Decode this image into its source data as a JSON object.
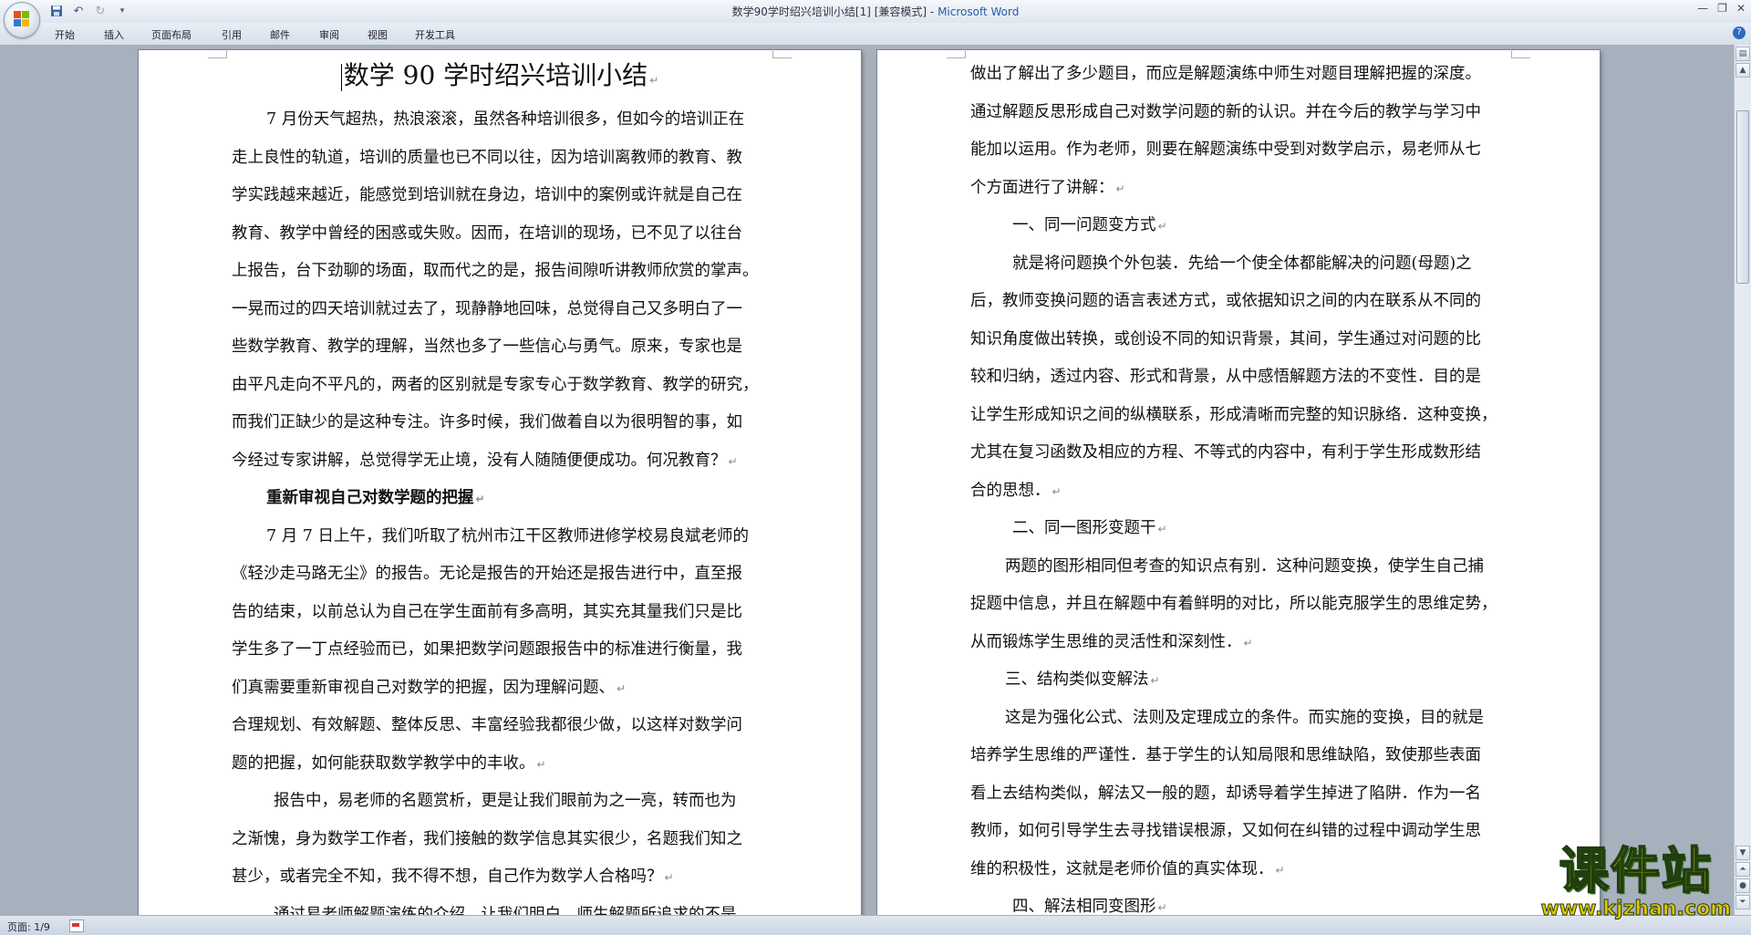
{
  "window": {
    "title": "数学90学时绍兴培训小结[1] [兼容模式] - ",
    "app_name": "Microsoft Word"
  },
  "ribbon_tabs": [
    "开始",
    "插入",
    "页面布局",
    "引用",
    "邮件",
    "审阅",
    "视图",
    "开发工具"
  ],
  "document": {
    "left_page": {
      "title": "数学 90 学时绍兴培训小结",
      "lines": [
        {
          "text": "7 月份天气超热，热浪滚滚，虽然各种培训很多，但如今的培训正在",
          "style": "indent",
          "mark": false
        },
        {
          "text": "走上良性的轨道，培训的质量也已不同以往，因为培训离教师的教育、教",
          "style": "",
          "mark": false
        },
        {
          "text": "学实践越来越近，能感觉到培训就在身边，培训中的案例或许就是自己在",
          "style": "",
          "mark": false
        },
        {
          "text": "教育、教学中曾经的困惑或失败。因而，在培训的现场，已不见了以往台",
          "style": "",
          "mark": false
        },
        {
          "text": "上报告，台下劲聊的场面，取而代之的是，报告间隙听讲教师欣赏的掌声。",
          "style": "",
          "mark": false
        },
        {
          "text": "一晃而过的四天培训就过去了，现静静地回味，总觉得自己又多明白了一",
          "style": "",
          "mark": false
        },
        {
          "text": "些数学教育、教学的理解，当然也多了一些信心与勇气。原来，专家也是",
          "style": "",
          "mark": false
        },
        {
          "text": "由平凡走向不平凡的，两者的区别就是专家专心于数学教育、教学的研究，",
          "style": "",
          "mark": false
        },
        {
          "text": "而我们正缺少的是这种专注。许多时候，我们做着自以为很明智的事，如",
          "style": "",
          "mark": false
        },
        {
          "text": "今经过专家讲解，总觉得学无止境，没有人随随便便成功。何况教育？",
          "style": "",
          "mark": true
        },
        {
          "text": "重新审视自己对数学题的把握",
          "style": "heading-bold",
          "mark": true
        },
        {
          "text": "7 月 7 日上午，我们听取了杭州市江干区教师进修学校易良斌老师的",
          "style": "indent",
          "mark": false
        },
        {
          "text": "《轻沙走马路无尘》的报告。无论是报告的开始还是报告进行中，直至报",
          "style": "",
          "mark": false
        },
        {
          "text": "告的结束，以前总认为自己在学生面前有多高明，其实充其量我们只是比",
          "style": "",
          "mark": false
        },
        {
          "text": "学生多了一丁点经验而已，如果把数学问题跟报告中的标准进行衡量，我",
          "style": "",
          "mark": false
        },
        {
          "text": "们真需要重新审视自己对数学的把握，因为理解问题、",
          "style": "",
          "mark": true
        },
        {
          "text": "合理规划、有效解题、整体反思、丰富经验我都很少做，以这样对数学问",
          "style": "",
          "mark": false
        },
        {
          "text": "题的把握，如何能获取数学教学中的丰收。",
          "style": "",
          "mark": true
        },
        {
          "text": "报告中，易老师的名题赏析，更是让我们眼前为之一亮，转而也为",
          "style": "indent-wide",
          "mark": false
        },
        {
          "text": "之渐愧，身为数学工作者，我们接触的数学信息其实很少，名题我们知之",
          "style": "",
          "mark": false
        },
        {
          "text": "甚少，或者完全不知，我不得不想，自己作为数学人合格吗？",
          "style": "",
          "mark": true
        },
        {
          "text": "通过易老师解题演练的介绍，让我们明白，师生解题所追求的不是",
          "style": "indent-wide",
          "mark": false
        }
      ]
    },
    "right_page": {
      "lines": [
        {
          "text": "做出了解出了多少题目，而应是解题演练中师生对题目理解把握的深度。",
          "style": "",
          "mark": false
        },
        {
          "text": "通过解题反思形成自己对数学问题的新的认识。并在今后的教学与学习中",
          "style": "",
          "mark": false
        },
        {
          "text": "能加以运用。作为老师，则要在解题演练中受到对数学启示，易老师从七",
          "style": "",
          "mark": false
        },
        {
          "text": "个方面进行了讲解：",
          "style": "",
          "mark": true
        },
        {
          "text": "一、同一问题变方式",
          "style": "section",
          "mark": true
        },
        {
          "text": "就是将问题换个外包装．先给一个使全体都能解决的问题(母题)之",
          "style": "indent-wide",
          "mark": false
        },
        {
          "text": "后，教师变换问题的语言表述方式，或依据知识之间的内在联系从不同的",
          "style": "",
          "mark": false
        },
        {
          "text": "知识角度做出转换，或创设不同的知识背景，其间，学生通过对问题的比",
          "style": "",
          "mark": false
        },
        {
          "text": "较和归纳，透过内容、形式和背景，从中感悟解题方法的不变性．目的是",
          "style": "",
          "mark": false
        },
        {
          "text": "让学生形成知识之间的纵横联系，形成清晰而完整的知识脉络．这种变换，",
          "style": "",
          "mark": false
        },
        {
          "text": "尤其在复习函数及相应的方程、不等式的内容中，有利于学生形成数形结",
          "style": "",
          "mark": false
        },
        {
          "text": "合的思想．",
          "style": "",
          "mark": true
        },
        {
          "text": "二、同一图形变题干",
          "style": "section",
          "mark": true
        },
        {
          "text": "两题的图形相同但考查的知识点有别．这种问题变换，使学生自己捕",
          "style": "indent",
          "mark": false
        },
        {
          "text": "捉题中信息，并且在解题中有着鲜明的对比，所以能克服学生的思维定势，",
          "style": "",
          "mark": false
        },
        {
          "text": "从而锻炼学生思维的灵活性和深刻性．",
          "style": "",
          "mark": true
        },
        {
          "text": "三、结构类似变解法",
          "style": "indent",
          "mark": true
        },
        {
          "text": "这是为强化公式、法则及定理成立的条件。而实施的变换，目的就是",
          "style": "indent",
          "mark": false
        },
        {
          "text": "培养学生思维的严谨性．基于学生的认知局限和思维缺陷，致使那些表面",
          "style": "",
          "mark": false
        },
        {
          "text": "看上去结构类似，解法又一般的题，却诱导着学生掉进了陷阱．作为一名",
          "style": "",
          "mark": false
        },
        {
          "text": "教师，如何引导学生去寻找错误根源，又如何在纠错的过程中调动学生思",
          "style": "",
          "mark": false
        },
        {
          "text": "维的积极性，这就是老师价值的真实体现．",
          "style": "",
          "mark": true
        },
        {
          "text": "四、解法相同变图形",
          "style": "section",
          "mark": true
        }
      ]
    }
  },
  "status_bar": {
    "page_info": "页面: 1/9"
  },
  "watermark": {
    "title": "课件站",
    "url": "www.kjzhan.com"
  },
  "icons": {
    "paragraph_mark": "↵"
  },
  "colors": {
    "app_title": "#2b5aa8",
    "watermark_fill": "#e8c400",
    "watermark_stroke": "#1f3f0f"
  }
}
